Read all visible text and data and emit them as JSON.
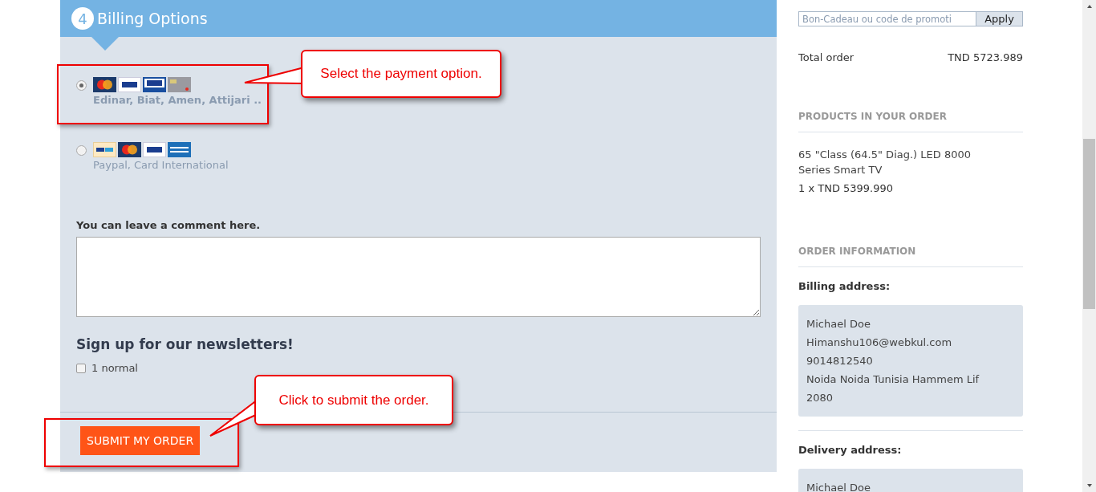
{
  "billing": {
    "step": "4",
    "title": "Billing Options",
    "payment_options": [
      {
        "selected": true,
        "label": "Edinar, Biat, Amen, Attijari ..",
        "cards": [
          {
            "kind": "mastercard"
          },
          {
            "kind": "visa"
          },
          {
            "kind": "visa-electron"
          },
          {
            "kind": "card"
          }
        ]
      },
      {
        "selected": false,
        "label": "Paypal, Card International",
        "cards": [
          {
            "kind": "paypal"
          },
          {
            "kind": "mastercard"
          },
          {
            "kind": "visa"
          },
          {
            "kind": "amex"
          }
        ]
      }
    ],
    "comment": {
      "label": "You can leave a comment here."
    },
    "newsletter": {
      "heading": "Sign up for our newsletters!",
      "options": [
        {
          "label": "1 normal",
          "checked": false
        }
      ]
    },
    "submit": "SUBMIT MY ORDER"
  },
  "annotations": [
    {
      "text": "Select the payment option."
    },
    {
      "text": "Click to submit the order."
    }
  ],
  "summary": {
    "coupon": {
      "placeholder": "Bon-Cadeau ou code de promoti",
      "button": "Apply"
    },
    "total": {
      "label": "Total order",
      "value": "TND 5723.989"
    },
    "products_heading": "PRODUCTS IN YOUR ORDER",
    "products": [
      {
        "name": "65 \"Class (64.5\" Diag.) LED 8000 Series Smart TV",
        "quantity": "1 x TND 5399.990"
      }
    ],
    "info_heading": "ORDER INFORMATION",
    "addresses": [
      {
        "title": "Billing address:",
        "lines": [
          "Michael Doe",
          "Himanshu106@webkul.com",
          "9014812540",
          "Noida Noida Tunisia Hammem Lif",
          "2080"
        ]
      },
      {
        "title": "Delivery address:",
        "lines": [
          "Michael Doe"
        ]
      }
    ]
  }
}
